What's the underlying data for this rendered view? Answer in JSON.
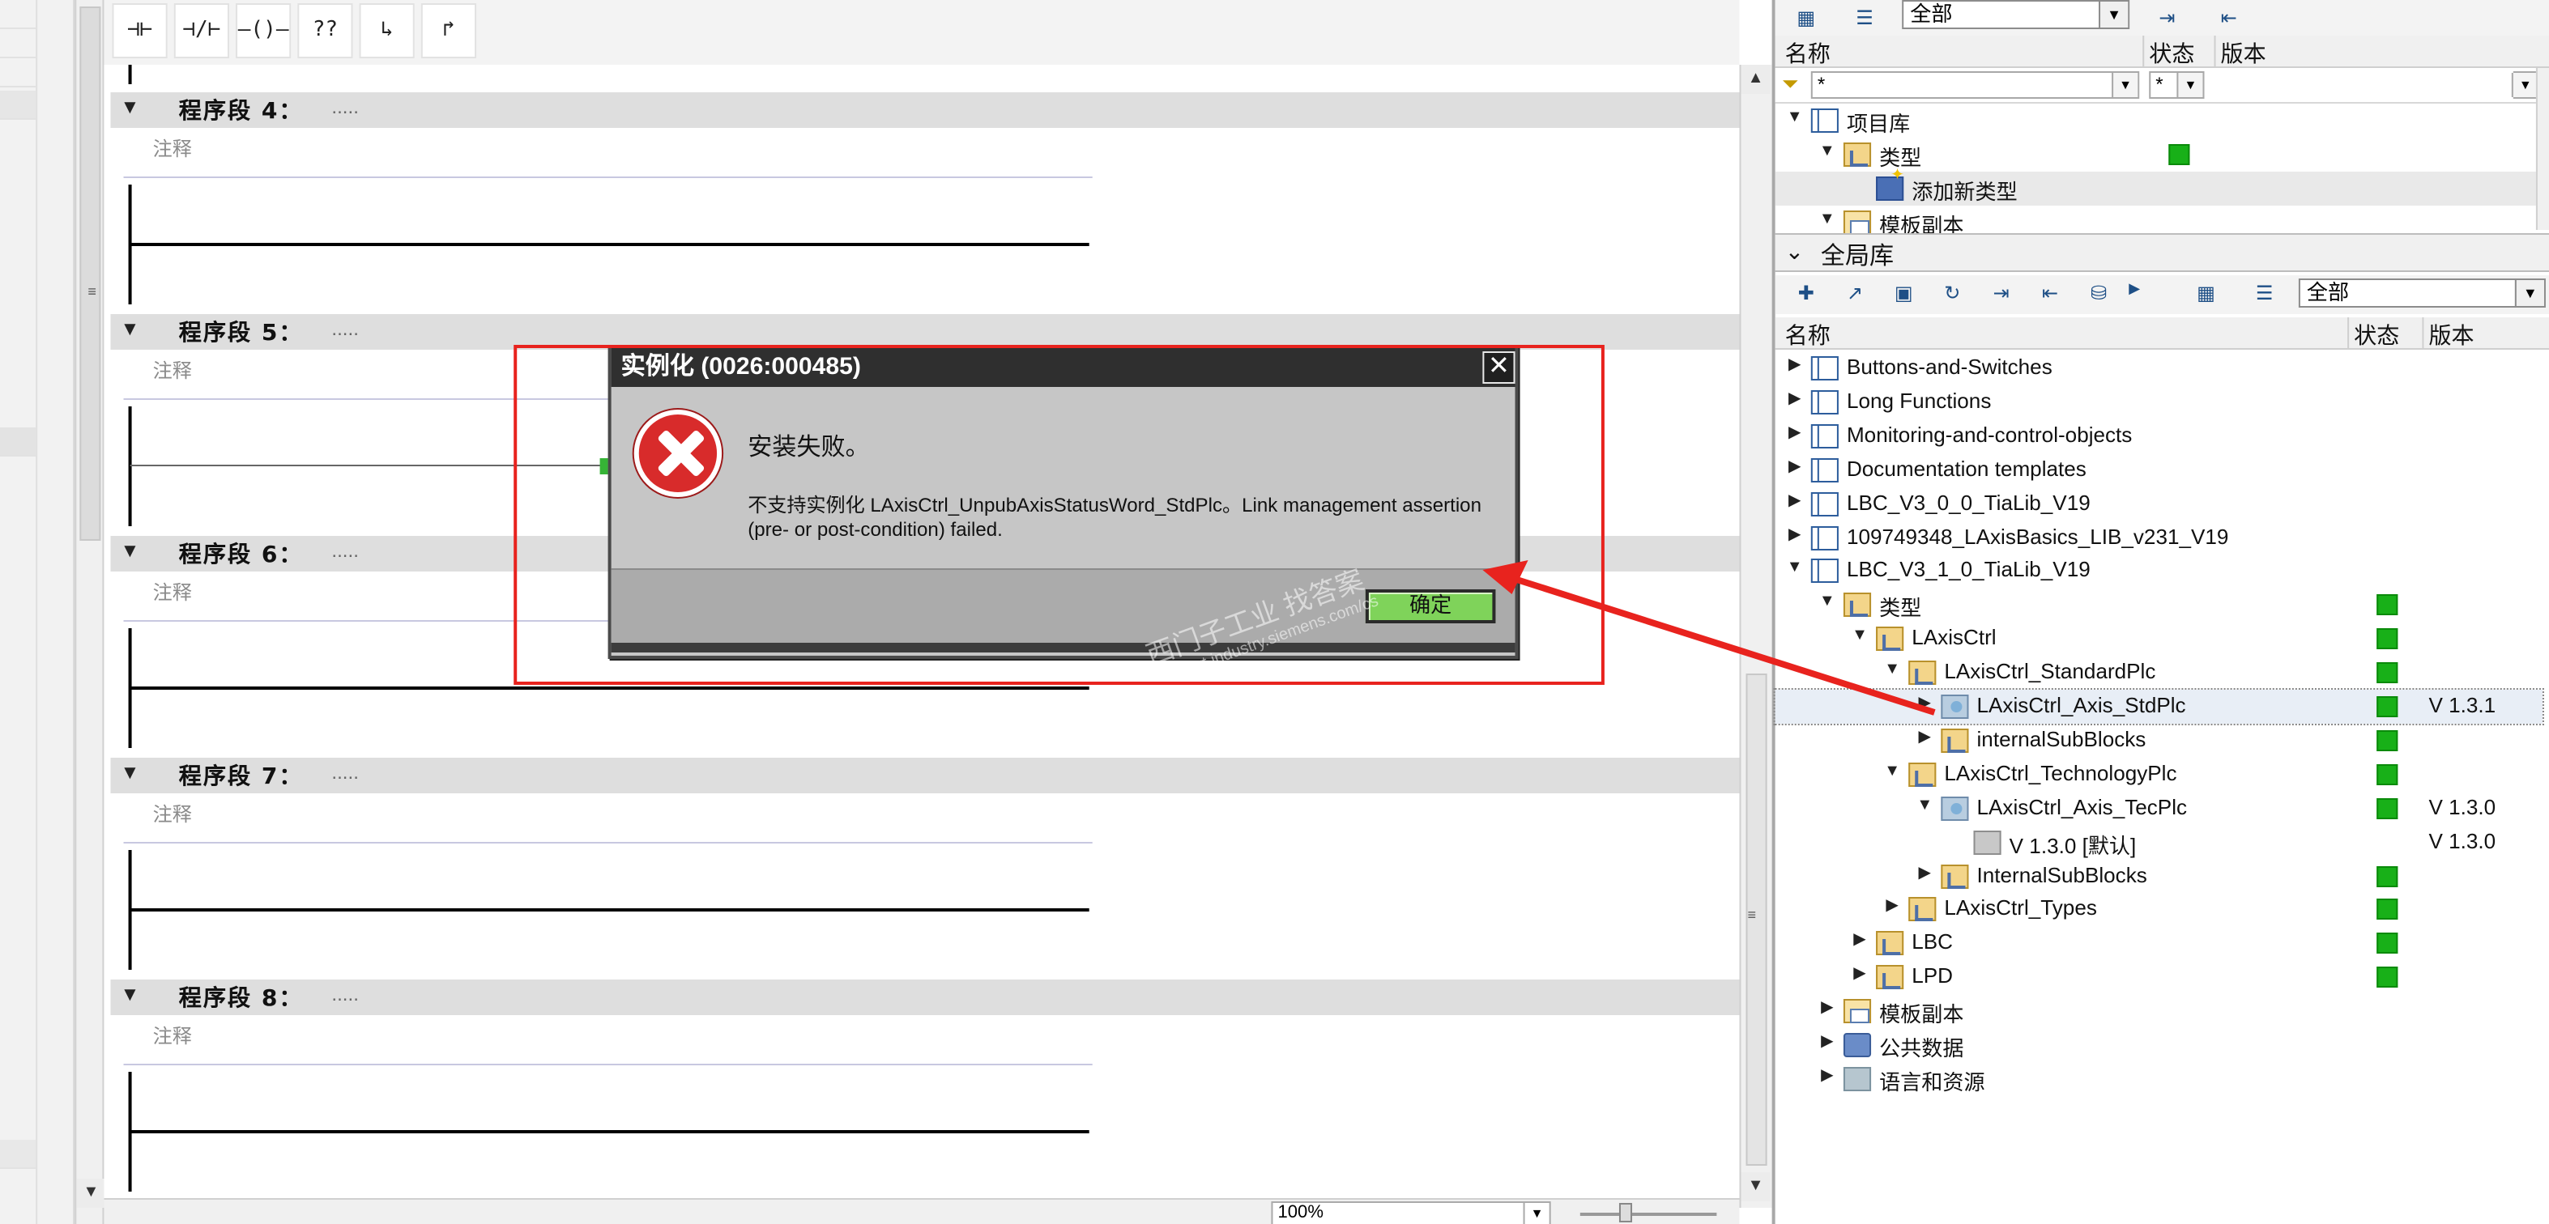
{
  "colors": {
    "dialog_bg": "#c6c6c6",
    "dialog_title_bg": "#2f2f2f",
    "ok_button": "#7fd35a",
    "error_red": "#d82b2b",
    "status_green": "#18b018",
    "annotation_red": "#e8231e",
    "network_header": "#dedede"
  },
  "ladder_toolbar": {
    "buttons": [
      {
        "name": "no-contact-button",
        "glyph": "⊣⊢"
      },
      {
        "name": "nc-contact-button",
        "glyph": "⊣/⊢"
      },
      {
        "name": "coil-button",
        "glyph": "—()—"
      },
      {
        "name": "empty-box-button",
        "glyph": "??"
      },
      {
        "name": "open-branch-button",
        "glyph": "↳"
      },
      {
        "name": "close-branch-button",
        "glyph": "↱"
      }
    ]
  },
  "networks": [
    {
      "title": "程序段 4：",
      "dots": ".....",
      "comment": "注释"
    },
    {
      "title": "程序段 5：",
      "dots": ".....",
      "comment": "注释"
    },
    {
      "title": "程序段 6：",
      "dots": ".....",
      "comment": "注释"
    },
    {
      "title": "程序段 7：",
      "dots": ".....",
      "comment": "注释"
    },
    {
      "title": "程序段 8：",
      "dots": ".....",
      "comment": "注释"
    }
  ],
  "zoom": {
    "value": "100%"
  },
  "project_library": {
    "filter_select": "全部",
    "columns": {
      "name": "名称",
      "status": "状态",
      "version": "版本"
    },
    "filter": {
      "name": "*",
      "status": "*"
    },
    "rows": [
      {
        "label": "项目库",
        "icon": "book-icon",
        "expand": "▼"
      },
      {
        "label": "类型",
        "icon": "type-folder-icon",
        "expand": "▼",
        "status": true
      },
      {
        "label": "添加新类型",
        "icon": "add-type-icon",
        "expand": ""
      },
      {
        "label": "模板副本",
        "icon": "folder-icon",
        "expand": "▼"
      }
    ]
  },
  "global_library": {
    "title": "全局库",
    "filter_select": "全部",
    "columns": {
      "name": "名称",
      "status": "状态",
      "version": "版本"
    },
    "rows": [
      {
        "label": "Buttons-and-Switches",
        "icon": "book-icon",
        "expand": "▶",
        "level": 0
      },
      {
        "label": "Long Functions",
        "icon": "book-icon",
        "expand": "▶",
        "level": 0
      },
      {
        "label": "Monitoring-and-control-objects",
        "icon": "book-icon",
        "expand": "▶",
        "level": 0
      },
      {
        "label": "Documentation templates",
        "icon": "book-icon",
        "expand": "▶",
        "level": 0
      },
      {
        "label": "LBC_V3_0_0_TiaLib_V19",
        "icon": "book-icon",
        "expand": "▶",
        "level": 0
      },
      {
        "label": "109749348_LAxisBasics_LIB_v231_V19",
        "icon": "book-icon",
        "expand": "▶",
        "level": 0
      },
      {
        "label": "LBC_V3_1_0_TiaLib_V19",
        "icon": "book-icon",
        "expand": "▼",
        "level": 0
      },
      {
        "label": "类型",
        "icon": "type-folder-icon",
        "expand": "▼",
        "level": 1,
        "status": true
      },
      {
        "label": "LAxisCtrl",
        "icon": "type-folder-icon",
        "expand": "▼",
        "level": 2,
        "status": true
      },
      {
        "label": "LAxisCtrl_StandardPlc",
        "icon": "type-folder-icon",
        "expand": "▼",
        "level": 3,
        "status": true
      },
      {
        "label": "LAxisCtrl_Axis_StdPlc",
        "icon": "block-icon",
        "expand": "▶",
        "level": 4,
        "status": true,
        "version": "V 1.3.1",
        "selected": true
      },
      {
        "label": "internalSubBlocks",
        "icon": "type-folder-icon",
        "expand": "▶",
        "level": 4,
        "status": true
      },
      {
        "label": "LAxisCtrl_TechnologyPlc",
        "icon": "type-folder-icon",
        "expand": "▼",
        "level": 3,
        "status": true
      },
      {
        "label": "LAxisCtrl_Axis_TecPlc",
        "icon": "block-icon",
        "expand": "▼",
        "level": 4,
        "status": true,
        "version": "V 1.3.0"
      },
      {
        "label": "V 1.3.0 [默认]",
        "icon": "version-icon",
        "expand": "",
        "level": 5,
        "version": "V 1.3.0"
      },
      {
        "label": "InternalSubBlocks",
        "icon": "type-folder-icon",
        "expand": "▶",
        "level": 4,
        "status": true
      },
      {
        "label": "LAxisCtrl_Types",
        "icon": "type-folder-icon",
        "expand": "▶",
        "level": 3,
        "status": true
      },
      {
        "label": "LBC",
        "icon": "type-folder-icon",
        "expand": "▶",
        "level": 2,
        "status": true
      },
      {
        "label": "LPD",
        "icon": "type-folder-icon",
        "expand": "▶",
        "level": 2,
        "status": true
      },
      {
        "label": "模板副本",
        "icon": "folder-icon",
        "expand": "▶",
        "level": 1
      },
      {
        "label": "公共数据",
        "icon": "data-icon",
        "expand": "▶",
        "level": 1
      },
      {
        "label": "语言和资源",
        "icon": "language-icon",
        "expand": "▶",
        "level": 1
      }
    ]
  },
  "dialog": {
    "title": "实例化 (0026:000485)",
    "close": "✕",
    "heading": "安装失败。",
    "message": "不支持实例化 LAxisCtrl_UnpubAxisStatusWord_StdPlc。Link management assertion (pre- or post-condition) failed.",
    "ok_label": "确定"
  },
  "watermark": {
    "line1": "西门子工业  找答案",
    "line2": "support.industry.siemens.com/cs"
  }
}
